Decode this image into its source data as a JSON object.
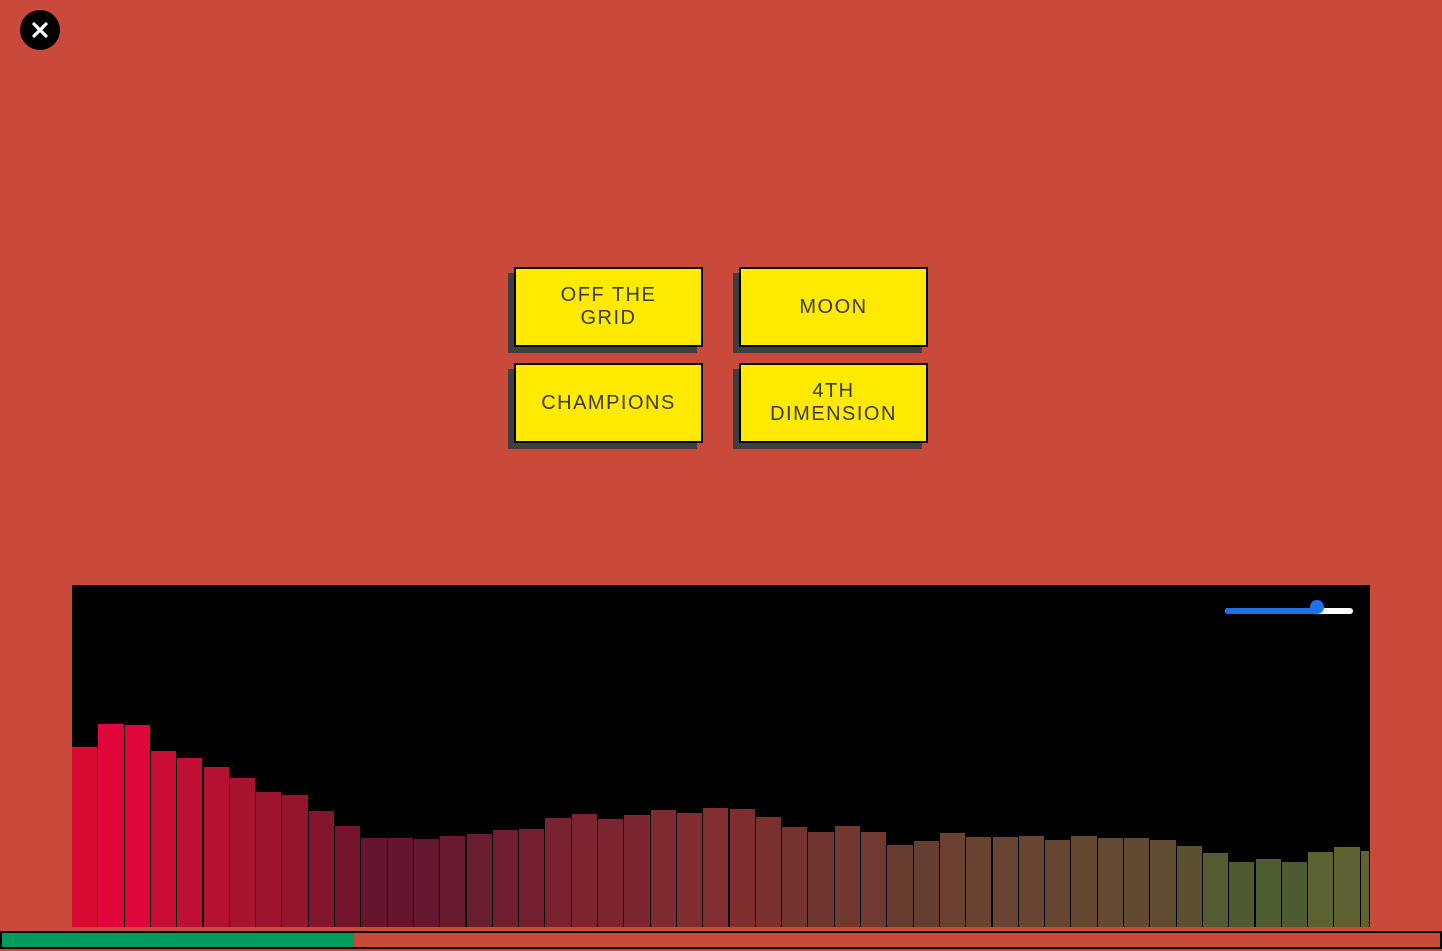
{
  "colors": {
    "background": "#c9493b",
    "button_fill": "#ffea00",
    "button_text": "#3a3a3a",
    "visualizer_background": "#000000",
    "progress_fill": "#009b5e",
    "volume_accent": "#1a73e8"
  },
  "close": {
    "icon": "close-icon"
  },
  "tracks": [
    {
      "label": "OFF THE\nGRID"
    },
    {
      "label": "MOON"
    },
    {
      "label": "CHAMPIONS"
    },
    {
      "label": "4TH\nDIMENSION"
    }
  ],
  "volume": {
    "value": 0.72
  },
  "playback": {
    "progress": 0.245
  },
  "visualizer": {
    "max_level": 342,
    "levels": [
      180,
      203,
      202,
      176,
      169,
      160,
      149,
      135,
      132,
      116,
      101,
      89,
      89,
      88,
      91,
      93,
      97,
      98,
      109,
      113,
      108,
      112,
      117,
      114,
      119,
      118,
      110,
      100,
      95,
      101,
      95,
      82,
      86,
      94,
      90,
      90,
      91,
      87,
      91,
      89,
      89,
      87,
      81,
      74,
      65,
      68,
      65,
      75,
      80,
      76
    ],
    "colors": [
      "#d80a32",
      "#e0053a",
      "#e0053a",
      "#c80c34",
      "#c00f34",
      "#b41031",
      "#a8132f",
      "#9c142e",
      "#94152d",
      "#84152e",
      "#74142f",
      "#661530",
      "#651530",
      "#651630",
      "#671a30",
      "#6a1c30",
      "#701e30",
      "#742030",
      "#7a2230",
      "#7e2430",
      "#7c2430",
      "#7c2631",
      "#7e2a30",
      "#802c30",
      "#822e30",
      "#7e2e2e",
      "#7a302c",
      "#74342e",
      "#70362e",
      "#72382e",
      "#703a30",
      "#663c30",
      "#643e30",
      "#6a4030",
      "#6a4232",
      "#6a4432",
      "#684432",
      "#664632",
      "#644832",
      "#644a32",
      "#624a32",
      "#604c32",
      "#5c5030",
      "#545a32",
      "#4e5a32",
      "#4e5c32",
      "#4e5a32",
      "#5a6232",
      "#5e6232",
      "#606232"
    ]
  }
}
